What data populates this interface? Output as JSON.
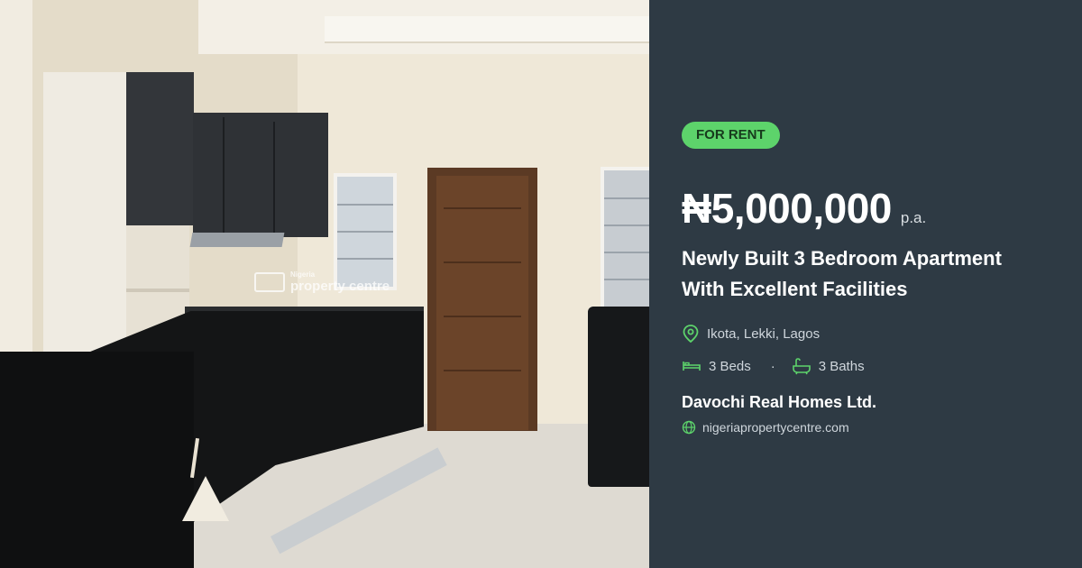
{
  "listing": {
    "badge": "FOR RENT",
    "price": "₦5,000,000",
    "price_unit": "p.a.",
    "title_line1": "Newly Built 3 Bedroom Apartment",
    "title_line2": "With Excellent Facilities",
    "location": "Ikota, Lekki, Lagos",
    "beds": "3 Beds",
    "separator": "·",
    "baths": "3 Baths",
    "agent": "Davochi Real Homes Ltd.",
    "website": "nigeriapropertycentre.com"
  },
  "photo": {
    "watermark_top": "Nigeria",
    "watermark_main": "property centre"
  },
  "icons": {
    "location": "map-pin-icon",
    "beds": "bed-icon",
    "baths": "bathtub-icon",
    "website": "globe-icon"
  },
  "colors": {
    "panel_bg": "#2e3a44",
    "badge_bg": "#5dd36b",
    "icon_green": "#5dd36b"
  }
}
